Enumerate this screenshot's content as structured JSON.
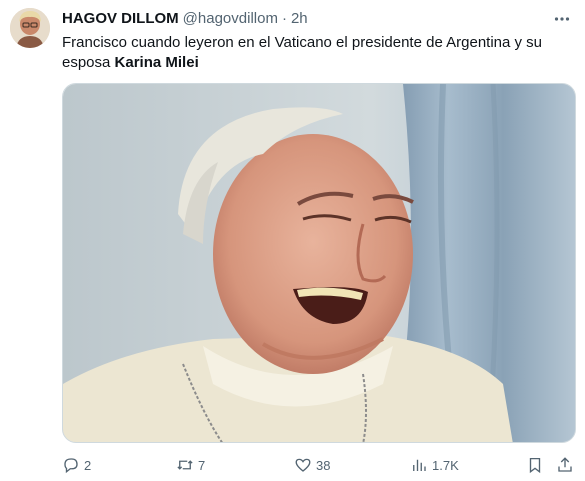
{
  "author": {
    "display_name": "HAGOV DILLOM",
    "handle": "@hagovdillom",
    "separator": "·",
    "time": "2h"
  },
  "tweet": {
    "text_prefix": "Francisco cuando leyeron en el Vaticano el presidente de Argentina y su esposa ",
    "text_bold": "Karina Milei"
  },
  "media": {
    "alt_icon": "photo-laughing-man"
  },
  "actions": {
    "reply_count": "2",
    "retweet_count": "7",
    "like_count": "38",
    "views_count": "1.7K"
  },
  "icons": {
    "reply": "reply-icon",
    "retweet": "retweet-icon",
    "like": "heart-icon",
    "views": "views-icon",
    "bookmark": "bookmark-icon",
    "share": "share-icon",
    "more": "more-icon"
  },
  "colors": {
    "text": "#0f1419",
    "secondary": "#536471",
    "border": "#cfd9de"
  }
}
